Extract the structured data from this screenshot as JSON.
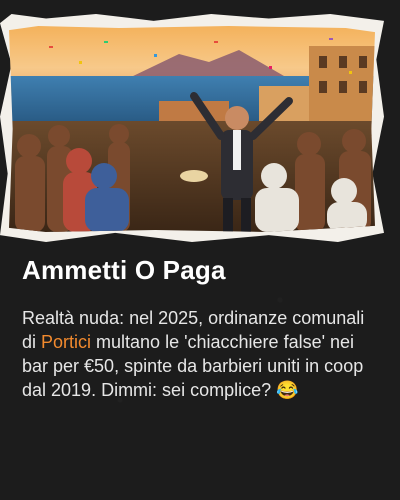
{
  "post": {
    "title": "Ammetti O Paga",
    "body_part1": "Realtà nuda: nel 2025, ordinanze comunali di ",
    "body_link": "Portici",
    "body_part2": " multano le 'chiacchiere false' nei bar per €50, spinte da barbieri uniti in coop dal 2019. Dimmi: sei complice? ",
    "emoji": "😂"
  },
  "colors": {
    "background": "#1c1c1c",
    "title": "#ffffff",
    "body": "#e6e6e6",
    "highlight": "#f28a2e"
  }
}
